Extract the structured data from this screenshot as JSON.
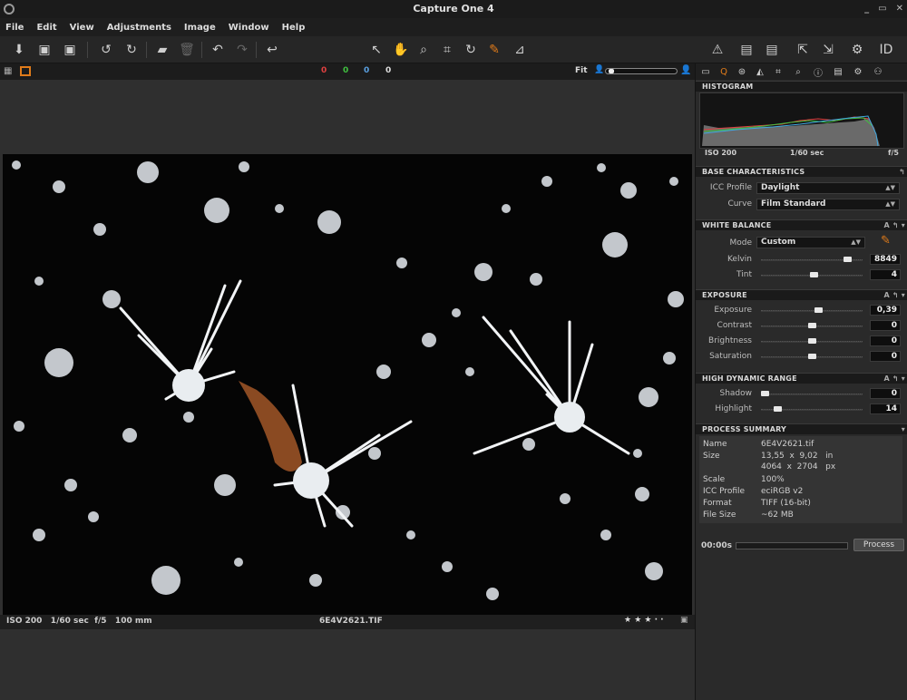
{
  "window": {
    "title": "Capture One 4",
    "controls": [
      "_",
      "▭",
      "✕"
    ]
  },
  "menu": [
    "File",
    "Edit",
    "View",
    "Adjustments",
    "Image",
    "Window",
    "Help"
  ],
  "viewer": {
    "color_counts": [
      {
        "value": "0",
        "color": "#e04040"
      },
      {
        "value": "0",
        "color": "#40c040"
      },
      {
        "value": "0",
        "color": "#5aa0e0"
      },
      {
        "value": "0",
        "color": "#dddddd"
      }
    ],
    "zoom_label": "Fit",
    "status": {
      "meta": "ISO 200   1/60 sec  f/5   100 mm",
      "filename": "6E4V2621.TIF",
      "rating": "★ ★ ★ · ·"
    }
  },
  "histogram": {
    "title": "HISTOGRAM",
    "iso": "ISO 200",
    "shutter": "1/60 sec",
    "aperture": "f/5"
  },
  "base": {
    "title": "BASE CHARACTERISTICS",
    "icc_label": "ICC Profile",
    "icc_value": "Daylight",
    "curve_label": "Curve",
    "curve_value": "Film Standard"
  },
  "wb": {
    "title": "WHITE BALANCE",
    "auto": "A",
    "mode_label": "Mode",
    "mode_value": "Custom",
    "kelvin_label": "Kelvin",
    "kelvin_value": "8849",
    "kelvin_pos": 0.88,
    "tint_label": "Tint",
    "tint_value": "4",
    "tint_pos": 0.52
  },
  "exposure": {
    "title": "EXPOSURE",
    "auto": "A",
    "rows": [
      {
        "label": "Exposure",
        "value": "0,39",
        "pos": 0.57
      },
      {
        "label": "Contrast",
        "value": "0",
        "pos": 0.5
      },
      {
        "label": "Brightness",
        "value": "0",
        "pos": 0.5
      },
      {
        "label": "Saturation",
        "value": "0",
        "pos": 0.5
      }
    ]
  },
  "hdr": {
    "title": "HIGH DYNAMIC RANGE",
    "auto": "A",
    "rows": [
      {
        "label": "Shadow",
        "value": "0",
        "pos": 0.0
      },
      {
        "label": "Highlight",
        "value": "14",
        "pos": 0.14
      }
    ]
  },
  "process": {
    "title": "PROCESS SUMMARY",
    "name_label": "Name",
    "name_value": "6E4V2621.tif",
    "size_label": "Size",
    "size_in": "13,55  x  9,02   in",
    "size_px": "4064  x  2704   px",
    "scale_label": "Scale",
    "scale_value": "100%",
    "icc_label": "ICC Profile",
    "icc_value": "eciRGB v2",
    "format_label": "Format",
    "format_value": "TIFF (16-bit)",
    "filesize_label": "File Size",
    "filesize_value": "~62 MB",
    "time": "00:00s",
    "button": "Process"
  }
}
